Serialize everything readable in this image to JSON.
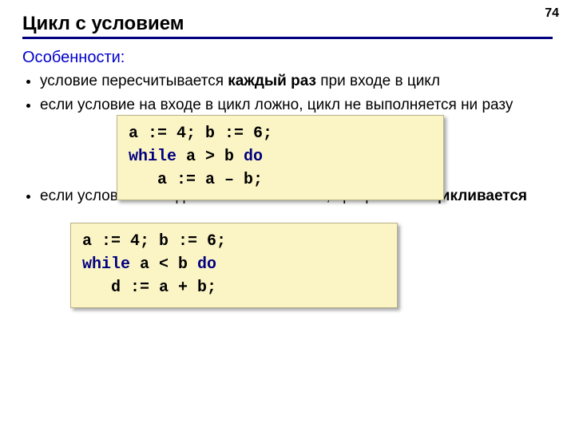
{
  "page_number": "74",
  "title": "Цикл с условием",
  "subhead": "Особенности:",
  "bullets": {
    "b1_pre": "условие пересчитывается ",
    "b1_bold": "каждый раз",
    "b1_post": " при входе в цикл",
    "b2": "если условие на входе в цикл ложно, цикл не выполняется ни разу",
    "b3_pre": "если условие никогда не станет ложным, программа ",
    "b3_bold": "зацикливается"
  },
  "code1": {
    "l1": "a := 4; b := 6;",
    "l2a": "while",
    "l2b": " a > b ",
    "l2c": "do",
    "l3": "   a := a – b;"
  },
  "code2": {
    "l1": "a := 4; b := 6;",
    "l2a": "while",
    "l2b": " a < b ",
    "l2c": "do",
    "l3": "   d := a + b;"
  }
}
